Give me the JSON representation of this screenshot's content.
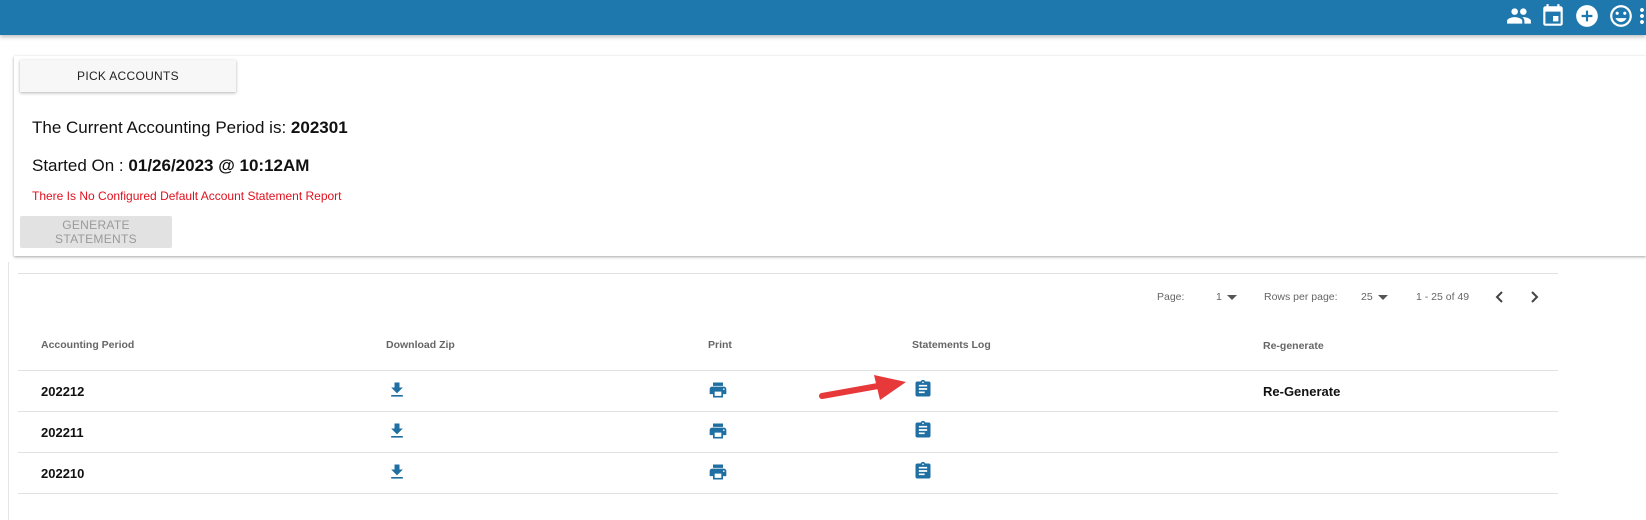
{
  "topbar": {
    "icons": [
      "people-icon",
      "calendar-icon",
      "add-circle-icon",
      "smiley-icon",
      "more-vert-icon"
    ],
    "color": "#1f78ad"
  },
  "controls": {
    "pick_accounts": "PICK ACCOUNTS",
    "generate_statements": "GENERATE STATEMENTS"
  },
  "period": {
    "label": "The Current Accounting Period is:",
    "value": "202301",
    "started_label": "Started On :",
    "started_value": "01/26/2023 @ 10:12AM",
    "warning": "There Is No Configured Default Account Statement Report"
  },
  "pagination": {
    "page_label": "Page:",
    "page_value": "1",
    "rows_label": "Rows per page:",
    "rows_value": "25",
    "range": "1 - 25 of 49"
  },
  "table": {
    "columns": {
      "period": "Accounting Period",
      "zip": "Download Zip",
      "print": "Print",
      "log": "Statements Log",
      "regen": "Re-generate"
    },
    "rows": [
      {
        "period": "202212",
        "regen": "Re-Generate"
      },
      {
        "period": "202211",
        "regen": ""
      },
      {
        "period": "202210",
        "regen": ""
      }
    ]
  },
  "colors": {
    "accent": "#1f6fa3",
    "warning": "#e0101e",
    "annotation_arrow": "#e8393a"
  }
}
